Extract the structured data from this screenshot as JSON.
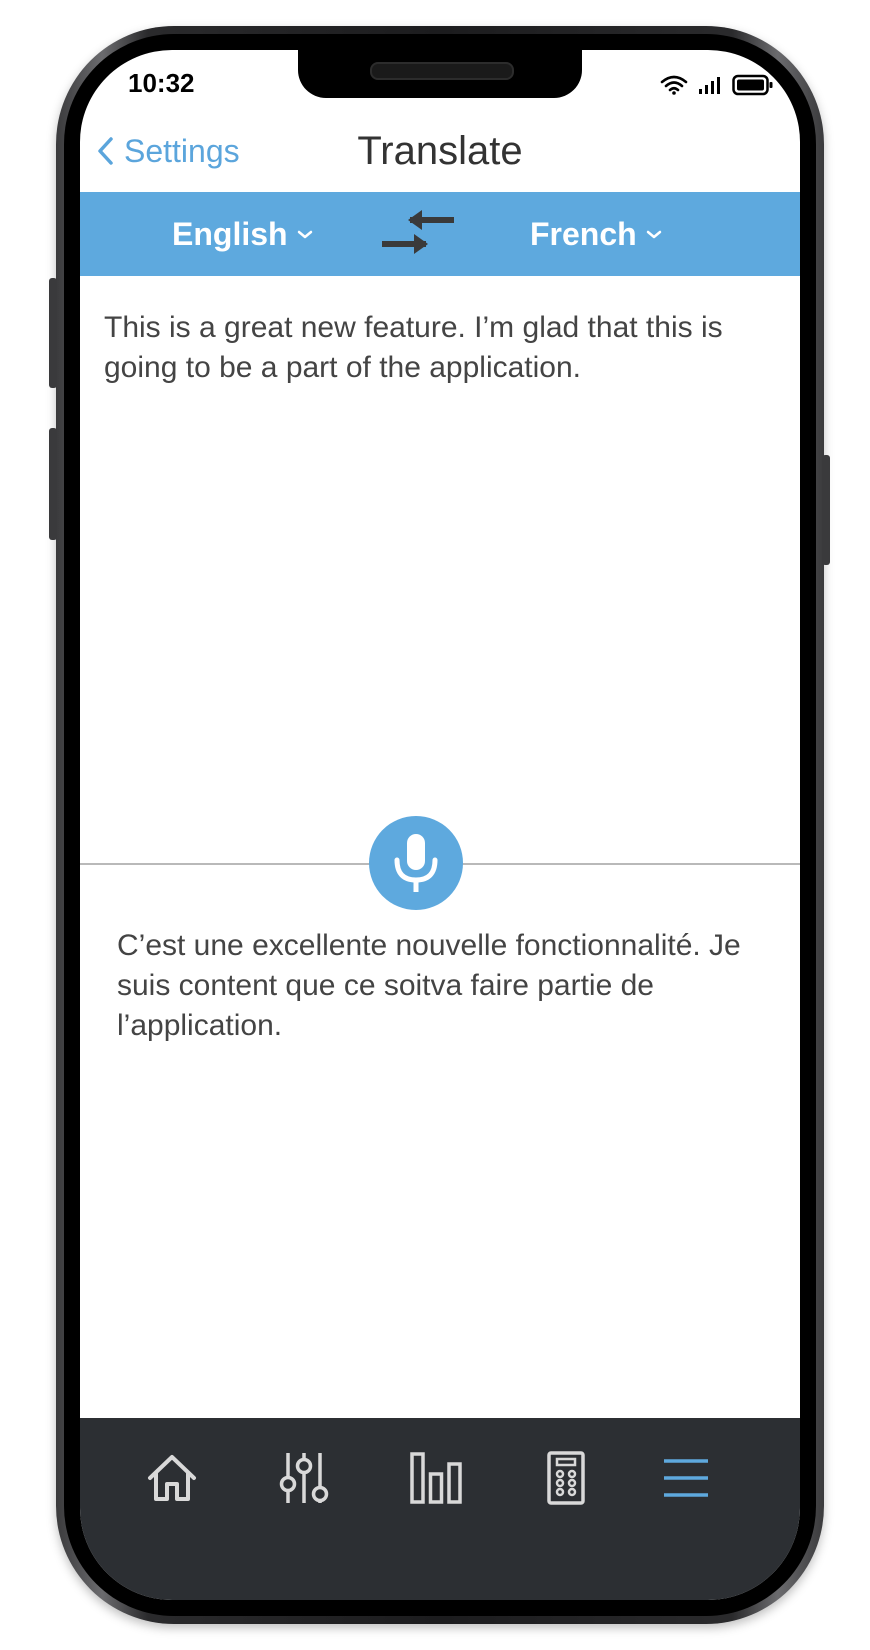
{
  "status_bar": {
    "time": "10:32",
    "icons": [
      "wifi-icon",
      "signal-icon",
      "battery-icon"
    ]
  },
  "nav": {
    "back_label": "Settings",
    "title": "Translate"
  },
  "language_bar": {
    "source_language": "English",
    "target_language": "French",
    "swap_icon": "swap-arrows-icon"
  },
  "translation": {
    "source_text": "This is a great new feature. I’m glad that this is going to be a part of the application.",
    "target_text": "C’est une excellente nouvelle fonctionnalité. Je suis content que ce soitva faire partie de l’application."
  },
  "tab_bar": {
    "tabs": [
      {
        "icon": "home-icon",
        "active": false
      },
      {
        "icon": "sliders-icon",
        "active": false
      },
      {
        "icon": "bar-chart-icon",
        "active": false
      },
      {
        "icon": "remote-control-icon",
        "active": false
      },
      {
        "icon": "menu-icon",
        "active": true
      }
    ]
  },
  "colors": {
    "accent": "#5ea9de",
    "tab_bar_bg": "#2c2f33",
    "tab_icon": "#d9d9d9",
    "text": "#444444"
  }
}
